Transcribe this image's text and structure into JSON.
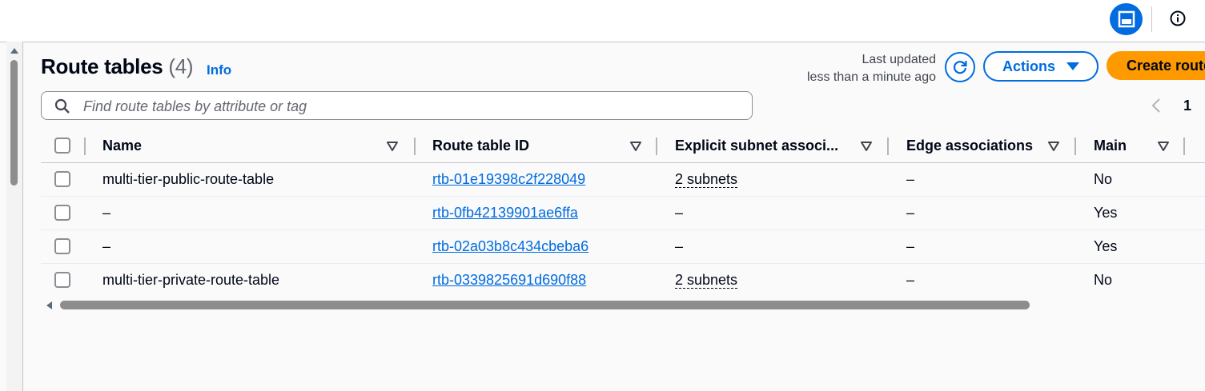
{
  "page": {
    "title": "Route tables",
    "count": "(4)",
    "info_link": "Info",
    "last_updated_line1": "Last updated",
    "last_updated_line2": "less than a minute ago",
    "actions_label": "Actions",
    "create_label": "Create route table"
  },
  "search": {
    "placeholder": "Find route tables by attribute or tag",
    "value": ""
  },
  "pagination": {
    "current_page": "1"
  },
  "table": {
    "columns": [
      "Name",
      "Route table ID",
      "Explicit subnet associ...",
      "Edge associations",
      "Main"
    ],
    "rows": [
      {
        "name": "multi-tier-public-route-table",
        "id": "rtb-01e19398c2f228049",
        "subnets": "2 subnets",
        "edge": "–",
        "main": "No"
      },
      {
        "name": "–",
        "id": "rtb-0fb42139901ae6ffa",
        "subnets": "–",
        "edge": "–",
        "main": "Yes"
      },
      {
        "name": "–",
        "id": "rtb-02a03b8c434cbeba6",
        "subnets": "–",
        "edge": "–",
        "main": "Yes"
      },
      {
        "name": "multi-tier-private-route-table",
        "id": "rtb-0339825691d690f88",
        "subnets": "2 subnets",
        "edge": "–",
        "main": "No"
      }
    ]
  },
  "colors": {
    "accent": "#006ce0",
    "primary_button": "#ff9900",
    "text": "#000716",
    "background": "#fafafa"
  },
  "icons": [
    "split-panel-icon",
    "info-icon",
    "refresh-icon",
    "caret-down-icon",
    "search-icon",
    "chevron-left-icon",
    "sort-icon",
    "checkbox-icon"
  ]
}
